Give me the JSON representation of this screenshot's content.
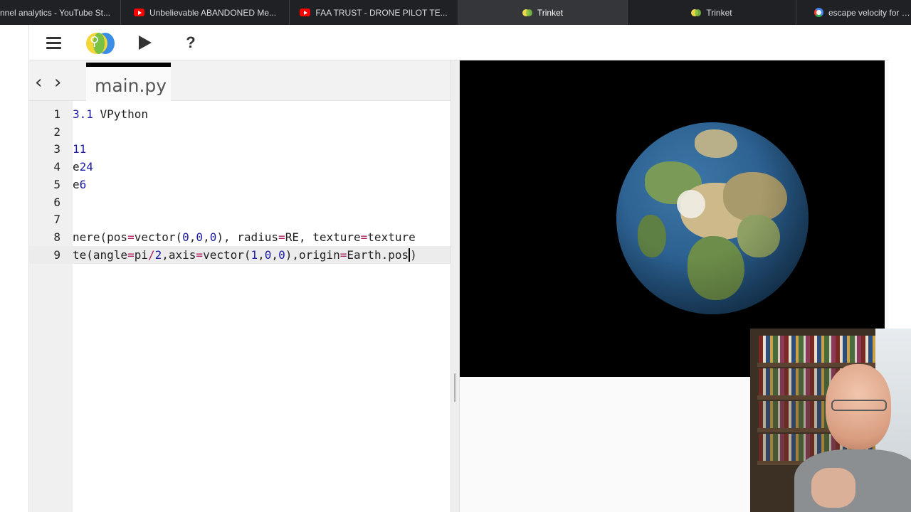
{
  "browser": {
    "tabs": [
      {
        "title": "nnel analytics - YouTube St...",
        "icon": "none",
        "active": false
      },
      {
        "title": "Unbelievable ABANDONED Me...",
        "icon": "youtube-icon",
        "active": false
      },
      {
        "title": "FAA TRUST - DRONE PILOT TE...",
        "icon": "youtube-icon",
        "active": false
      },
      {
        "title": "Trinket",
        "icon": "trinket-icon",
        "active": true
      },
      {
        "title": "Trinket",
        "icon": "trinket-icon",
        "active": false
      },
      {
        "title": "escape velocity for ear",
        "icon": "google-icon",
        "active": false
      }
    ]
  },
  "toolbar": {
    "menu_icon": "menu-icon",
    "logo_icon": "trinket-logo",
    "run_icon": "play-icon",
    "help_label": "?"
  },
  "editor": {
    "nav_prev": "‹",
    "nav_next": "›",
    "file_name": "main.py",
    "lines": [
      {
        "n": "1",
        "text": "3.1 VPython"
      },
      {
        "n": "2",
        "text": ""
      },
      {
        "n": "3",
        "text": "11"
      },
      {
        "n": "4",
        "text": "e24"
      },
      {
        "n": "5",
        "text": "e6"
      },
      {
        "n": "6",
        "text": ""
      },
      {
        "n": "7",
        "text": ""
      },
      {
        "n": "8",
        "text": "nere(pos=vector(0,0,0), radius=RE, texture=texture"
      },
      {
        "n": "9",
        "text": "te(angle=pi/2,axis=vector(1,0,0),origin=Earth.pos)"
      }
    ],
    "active_line": "9"
  },
  "output": {
    "scene": "3d-earth-sphere"
  },
  "colors": {
    "tab_bar": "#202124",
    "active_tab": "#35363a",
    "canvas_bg": "#000000",
    "number": "#1a1aa6",
    "operator": "#a71d5d"
  }
}
